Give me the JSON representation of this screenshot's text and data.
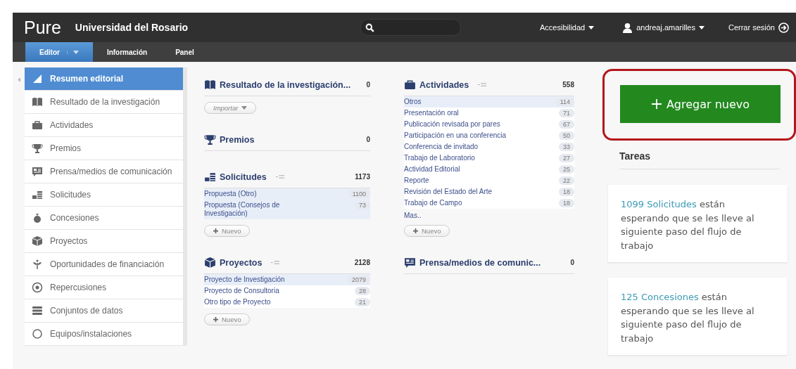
{
  "header": {
    "logo": "Pure",
    "institution": "Universidad del Rosario",
    "menus": [
      {
        "kind": "plain",
        "label": "Accesibilidad"
      },
      {
        "kind": "user",
        "label": "andreaj.amarilles"
      }
    ],
    "logout": "Cerrar sesión"
  },
  "tabs": [
    {
      "label": "Editor",
      "selected": true,
      "dropdown": true
    },
    {
      "label": "Información",
      "selected": false,
      "dropdown": false
    },
    {
      "label": "Panel",
      "selected": false,
      "dropdown": false
    }
  ],
  "sidebar": {
    "items": [
      {
        "label": "Resumen editorial",
        "selected": true
      },
      {
        "label": "Resultado de la investigación",
        "selected": false
      },
      {
        "label": "Actividades",
        "selected": false
      },
      {
        "label": "Premios",
        "selected": false
      },
      {
        "label": "Prensa/medios de comunicación",
        "selected": false
      },
      {
        "label": "Solicitudes",
        "selected": false
      },
      {
        "label": "Concesiones",
        "selected": false
      },
      {
        "label": "Proyectos",
        "selected": false
      },
      {
        "label": "Oportunidades de financiación",
        "selected": false
      },
      {
        "label": "Repercusiones",
        "selected": false
      },
      {
        "label": "Conjuntos de datos",
        "selected": false
      },
      {
        "label": "Equipos/instalaciones",
        "selected": false
      }
    ]
  },
  "columns": [
    [
      {
        "title": "Resultado de la investigación...",
        "count": "0",
        "sortable": false,
        "button": {
          "kind": "import",
          "label": "Importar"
        }
      },
      {
        "title": "Premios",
        "count": "0",
        "sortable": false
      },
      {
        "title": "Solicitudes",
        "count": "1173",
        "sortable": true,
        "items": [
          {
            "label": "Propuesta (Otro)",
            "count": "1100",
            "highlighted": true
          },
          {
            "label": "Propuesta (Consejos de Investigación)",
            "count": "73",
            "highlighted": true
          }
        ],
        "button": {
          "kind": "new",
          "label": "Nuevo"
        }
      },
      {
        "title": "Proyectos",
        "count": "2128",
        "sortable": true,
        "items": [
          {
            "label": "Proyecto de Investigación",
            "count": "2079",
            "highlighted": true
          },
          {
            "label": "Proyecto de Consultoria",
            "count": "28",
            "highlighted": false
          },
          {
            "label": "Otro tipo de Proyecto",
            "count": "21",
            "highlighted": false
          }
        ],
        "button": {
          "kind": "new",
          "label": "Nuevo"
        }
      }
    ],
    [
      {
        "title": "Actividades",
        "count": "558",
        "sortable": true,
        "items": [
          {
            "label": "Otros",
            "count": "114",
            "highlighted": true
          },
          {
            "label": "Presentación oral",
            "count": "71",
            "highlighted": false
          },
          {
            "label": "Publicación revisada por pares",
            "count": "67",
            "highlighted": false
          },
          {
            "label": "Participación en una conferencia",
            "count": "50",
            "highlighted": false
          },
          {
            "label": "Conferencia de invitado",
            "count": "33",
            "highlighted": false
          },
          {
            "label": "Trabajo de Laboratorio",
            "count": "27",
            "highlighted": false
          },
          {
            "label": "Actividad Editorial",
            "count": "25",
            "highlighted": false
          },
          {
            "label": "Reporte",
            "count": "22",
            "highlighted": false
          },
          {
            "label": "Revisión del Estado del Arte",
            "count": "18",
            "highlighted": false
          },
          {
            "label": "Trabajo de Campo",
            "count": "18",
            "highlighted": false
          }
        ],
        "more": "Mas..",
        "button": {
          "kind": "new",
          "label": "Nuevo"
        }
      },
      {
        "title": "Prensa/medios de comunic...",
        "count": "0",
        "sortable": false
      }
    ]
  ],
  "add_button": "Agregar nuevo",
  "tasks": {
    "title": "Tareas",
    "cards": [
      {
        "link": "1099 Solicitudes",
        "text": "están esperando que se les lleve al siguiente paso del flujo de trabajo"
      },
      {
        "link": "125 Concesiones",
        "text": "están esperando que se les lleve al siguiente paso del flujo de trabajo"
      }
    ]
  }
}
